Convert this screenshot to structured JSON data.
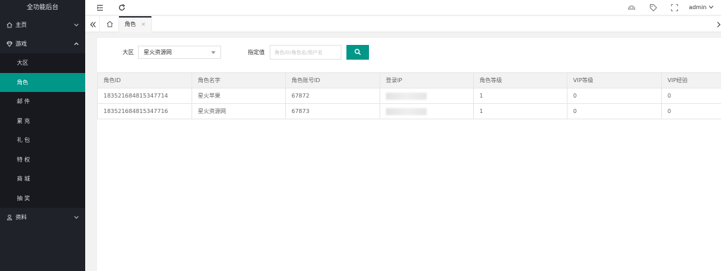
{
  "app": {
    "title": "全功能后台"
  },
  "sidebar": {
    "items": [
      {
        "label": "主页",
        "icon": "home-icon",
        "expanded": false
      },
      {
        "label": "游戏",
        "icon": "diamond-icon",
        "expanded": true,
        "children": [
          {
            "label": "大区",
            "active": false
          },
          {
            "label": "角色",
            "active": true
          },
          {
            "label": "邮 件",
            "active": false
          },
          {
            "label": "累 充",
            "active": false
          },
          {
            "label": "礼 包",
            "active": false
          },
          {
            "label": "特 权",
            "active": false
          },
          {
            "label": "商 城",
            "active": false
          },
          {
            "label": "抽 奖",
            "active": false
          }
        ]
      },
      {
        "label": "资料",
        "icon": "user-icon",
        "expanded": false
      }
    ]
  },
  "topbar": {
    "user": "admin"
  },
  "tabs": [
    {
      "label": "角色",
      "close": "×",
      "active": true
    }
  ],
  "form": {
    "region_label": "大区",
    "region_selected": "星火资源网",
    "value_label": "指定值",
    "value_placeholder": "角色ID/角色名/用户名"
  },
  "table": {
    "headers": [
      "角色ID",
      "角色名字",
      "角色账号ID",
      "登录IP",
      "角色等级",
      "VIP等级",
      "VIP经验"
    ],
    "rows": [
      [
        "183521684815347714",
        "星火苹果",
        "67872",
        "",
        "1",
        "0",
        "0"
      ],
      [
        "183521684815347716",
        "星火资源网",
        "67873",
        "",
        "1",
        "0",
        "0"
      ]
    ]
  },
  "colors": {
    "accent": "#009688",
    "sidebar_bg": "#20222a"
  }
}
